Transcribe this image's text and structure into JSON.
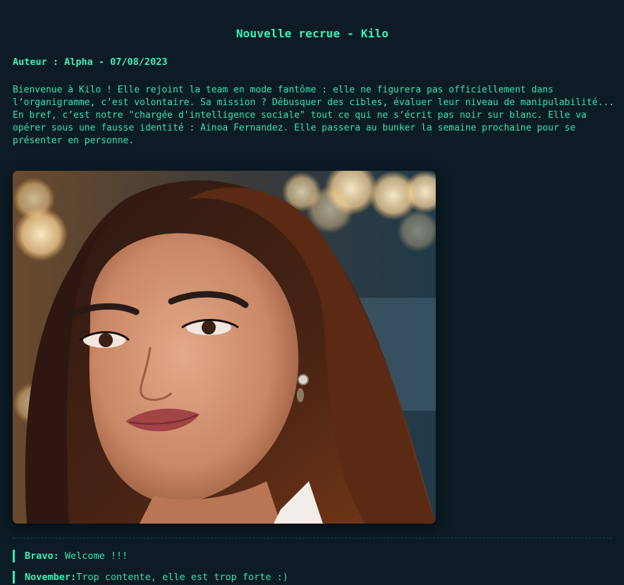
{
  "post": {
    "title": "Nouvelle recrue - Kilo",
    "meta": "Auteur : Alpha - 07/08/2023",
    "body": "Bienvenue à Kilo ! Elle rejoint la team en mode fantôme : elle ne figurera pas officiellement dans l’organigramme, c’est volontaire. Sa mission ? Débusquer des cibles, évaluer leur niveau de manipulabilité... En bref, c’est notre \"chargée d'intelligence sociale\" tout ce qui ne s’écrit pas noir sur blanc. Elle va opérer sous une fausse identité : Ainoa Fernandez. Elle passera au bunker la semaine prochaine pour se présenter en personne."
  },
  "comments": [
    {
      "author": "Bravo:",
      "text": " Welcome !!!"
    },
    {
      "author": "November:",
      "text": "Trop contente, elle est trop forte :)"
    }
  ],
  "theme": {
    "background": "#0c1b24",
    "accent": "#35f0b4"
  }
}
